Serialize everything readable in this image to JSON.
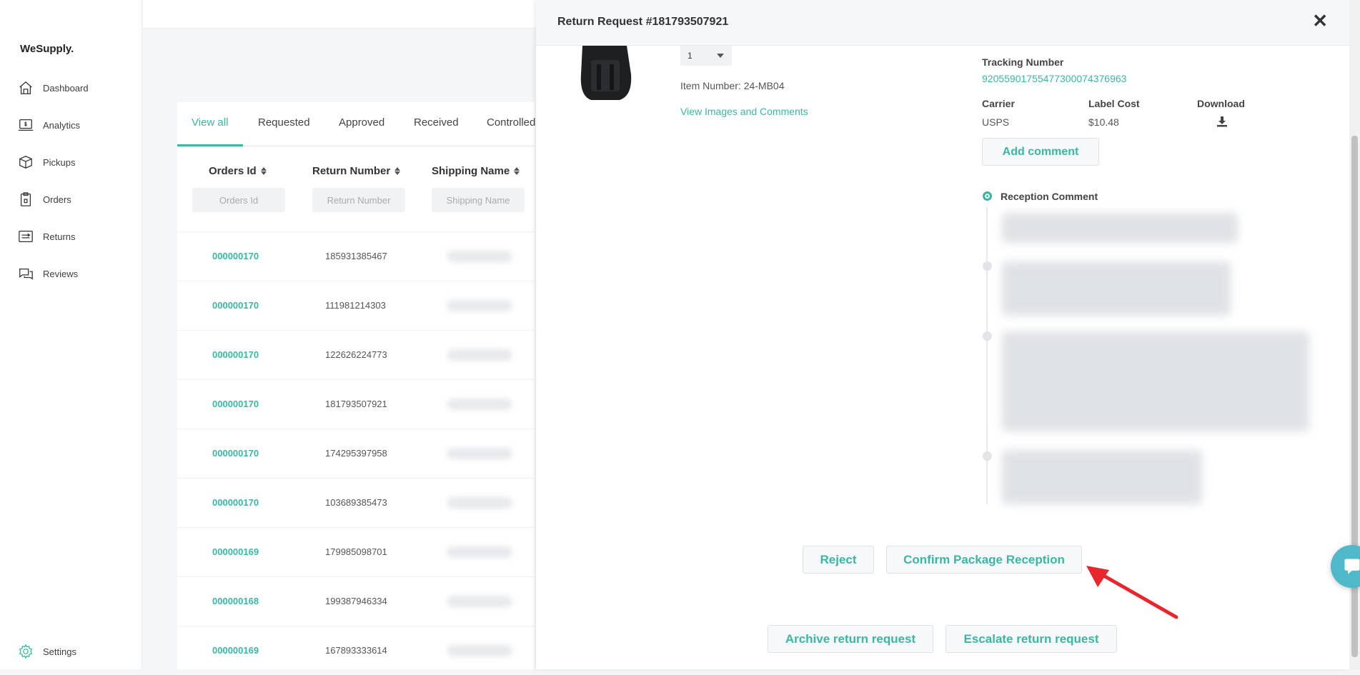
{
  "sidebar": {
    "brand": "WeSupply.",
    "items": [
      {
        "label": "Dashboard",
        "icon": "home-icon"
      },
      {
        "label": "Analytics",
        "icon": "analytics-icon"
      },
      {
        "label": "Pickups",
        "icon": "box-icon"
      },
      {
        "label": "Orders",
        "icon": "clipboard-icon"
      },
      {
        "label": "Returns",
        "icon": "returns-icon"
      },
      {
        "label": "Reviews",
        "icon": "chat-icon"
      }
    ],
    "settings_label": "Settings"
  },
  "tabs": [
    "View all",
    "Requested",
    "Approved",
    "Received",
    "Controlled"
  ],
  "table": {
    "columns": [
      "Orders Id",
      "Return Number",
      "Shipping Name"
    ],
    "filters": {
      "orders_id": "Orders Id",
      "return_number": "Return Number",
      "shipping_name": "Shipping Name"
    },
    "rows": [
      {
        "order_id": "000000170",
        "return_number": "185931385467"
      },
      {
        "order_id": "000000170",
        "return_number": "111981214303"
      },
      {
        "order_id": "000000170",
        "return_number": "122626224773"
      },
      {
        "order_id": "000000170",
        "return_number": "181793507921"
      },
      {
        "order_id": "000000170",
        "return_number": "174295397958"
      },
      {
        "order_id": "000000170",
        "return_number": "103689385473"
      },
      {
        "order_id": "000000169",
        "return_number": "179985098701"
      },
      {
        "order_id": "000000168",
        "return_number": "199387946334"
      },
      {
        "order_id": "000000169",
        "return_number": "167893333614"
      }
    ]
  },
  "panel": {
    "title": "Return Request #181793507921",
    "quantity": "1",
    "item_number": "Item Number: 24-MB04",
    "view_images_link": "View Images and Comments",
    "tracking_label": "Tracking Number",
    "tracking_number": "9205590175547730007437696​3",
    "carrier_label": "Carrier",
    "carrier_value": "USPS",
    "label_cost_label": "Label Cost",
    "label_cost_value": "$10.48",
    "download_label": "Download",
    "add_comment": "Add comment",
    "reception_comment_label": "Reception Comment",
    "reject": "Reject",
    "confirm": "Confirm Package Reception",
    "archive": "Archive return request",
    "escalate": "Escalate return request"
  },
  "colors": {
    "accent": "#3ab7a3",
    "annotation_arrow": "#e8262b",
    "chat": "#4fb8c9"
  }
}
